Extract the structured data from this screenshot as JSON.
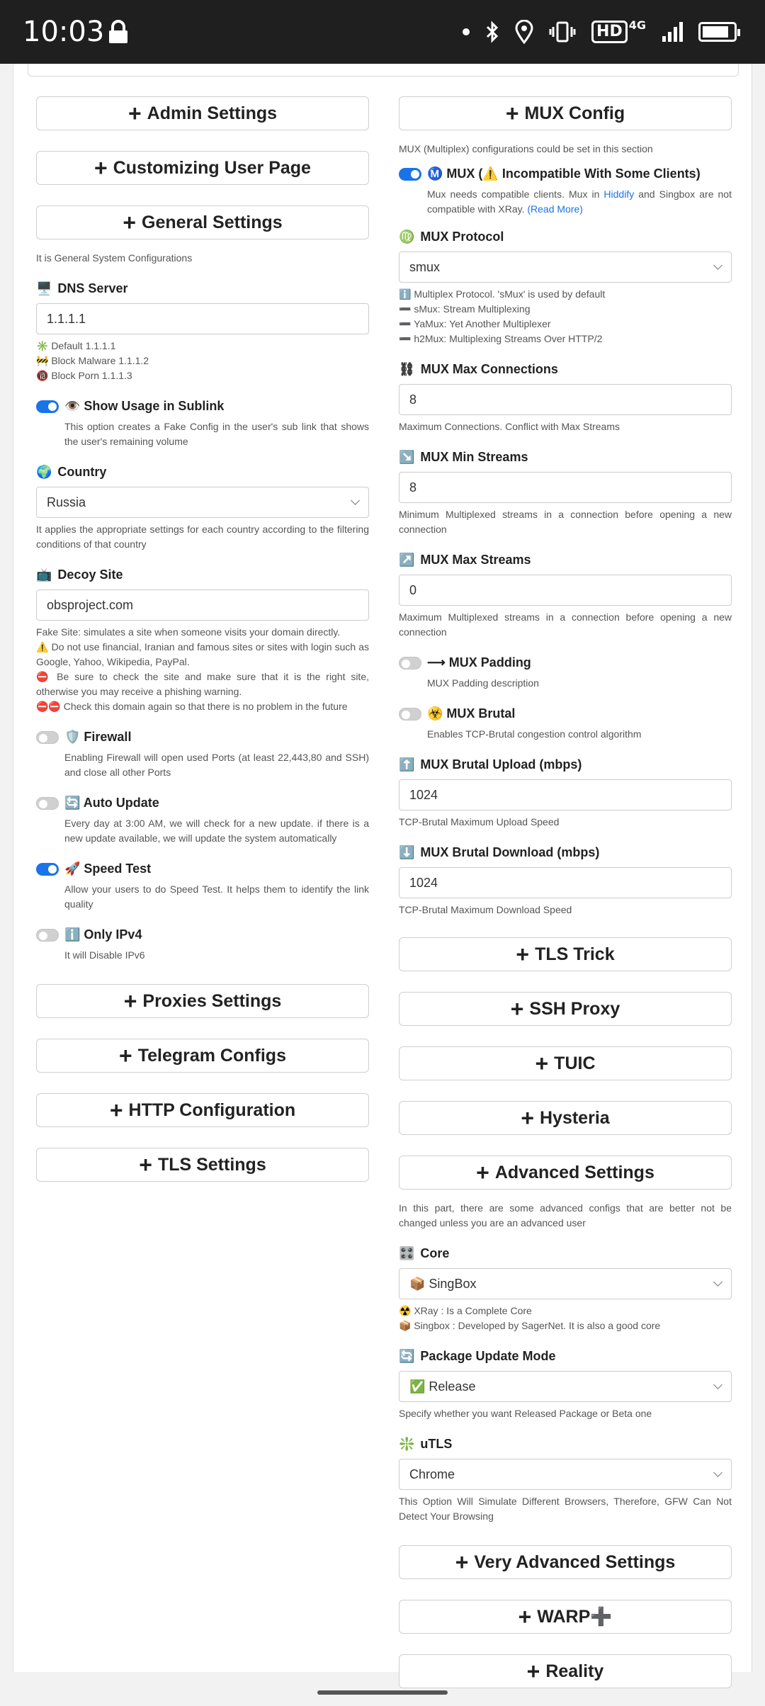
{
  "status_bar": {
    "time": "10:03",
    "network": "4G"
  },
  "left": {
    "admin_settings": "Admin Settings",
    "customizing_user_page": "Customizing User Page",
    "general_settings": "General Settings",
    "general_desc": "It is General System Configurations",
    "dns_label": "DNS Server",
    "dns_value": "1.1.1.1",
    "dns_hints": [
      "✳️ Default 1.1.1.1",
      "🚧 Block Malware 1.1.1.2",
      "🔞 Block Porn 1.1.1.3"
    ],
    "show_usage_label": "👁️ Show Usage in Sublink",
    "show_usage_desc": "This option creates a Fake Config in the user's sub link that shows the user's remaining volume",
    "country_label": "Country",
    "country_value": "Russia",
    "country_desc": "It applies the appropriate settings for each country according to the filtering conditions of that country",
    "decoy_label": "Decoy Site",
    "decoy_value": "obsproject.com",
    "decoy_notes": [
      "Fake Site: simulates a site when someone visits your domain directly.",
      "⚠️ Do not use financial, Iranian and famous sites or sites with login such as Google, Yahoo, Wikipedia, PayPal.",
      "⛔ Be sure to check the site and make sure that it is the right site, otherwise you may receive a phishing warning.",
      "⛔⛔ Check this domain again so that there is no problem in the future"
    ],
    "firewall_label": "🛡️ Firewall",
    "firewall_desc": "Enabling Firewall will open used Ports (at least 22,443,80 and SSH) and close all other Ports",
    "auto_update_label": "🔄 Auto Update",
    "auto_update_desc": "Every day at 3:00 AM, we will check for a new update. if there is a new update available, we will update the system automatically",
    "speed_test_label": "🚀 Speed Test",
    "speed_test_desc": "Allow your users to do Speed Test. It helps them to identify the link quality",
    "only_ipv4_label": "ℹ️ Only IPv4",
    "only_ipv4_desc": "It will Disable IPv6",
    "proxies_settings": "Proxies Settings",
    "telegram_configs": "Telegram Configs",
    "http_configuration": "HTTP Configuration",
    "tls_settings": "TLS Settings"
  },
  "right": {
    "mux_config": "MUX Config",
    "mux_config_desc": "MUX (Multiplex) configurations could be set in this section",
    "mux_label": "Ⓜ️ MUX (⚠️ Incompatible With Some Clients)",
    "mux_desc_1": "Mux needs compatible clients. Mux in ",
    "mux_desc_link": "Hiddify",
    "mux_desc_2": " and Singbox are not compatible with XRay. ",
    "mux_desc_readmore": "(Read More)",
    "mux_protocol_label": "MUX Protocol",
    "mux_protocol_value": "smux",
    "mux_protocol_hints": [
      "ℹ️ Multiplex Protocol. 'sMux' is used by default",
      "➖ sMux: Stream Multiplexing",
      "➖ YaMux: Yet Another Multiplexer",
      "➖ h2Mux: Multiplexing Streams Over HTTP/2"
    ],
    "max_conn_label": "MUX Max Connections",
    "max_conn_value": "8",
    "max_conn_desc": "Maximum Connections. Conflict with Max Streams",
    "min_streams_label": "MUX Min Streams",
    "min_streams_value": "8",
    "min_streams_desc": "Minimum Multiplexed streams in a connection before opening a new connection",
    "max_streams_label": "MUX Max Streams",
    "max_streams_value": "0",
    "max_streams_desc": "Maximum Multiplexed streams in a connection before opening a new connection",
    "padding_label": "⟶ MUX Padding",
    "padding_desc": "MUX Padding description",
    "brutal_label": "☣️ MUX Brutal",
    "brutal_desc": "Enables TCP-Brutal congestion control algorithm",
    "brutal_up_label": "MUX Brutal Upload (mbps)",
    "brutal_up_value": "1024",
    "brutal_up_desc": "TCP-Brutal Maximum Upload Speed",
    "brutal_down_label": "MUX Brutal Download (mbps)",
    "brutal_down_value": "1024",
    "brutal_down_desc": "TCP-Brutal Maximum Download Speed",
    "tls_trick": "TLS Trick",
    "ssh_proxy": "SSH Proxy",
    "tuic": "TUIC",
    "hysteria": "Hysteria",
    "advanced_settings": "Advanced Settings",
    "advanced_desc": "In this part, there are some advanced configs that are better not be changed unless you are an advanced user",
    "core_label": "Core",
    "core_value": "📦 SingBox",
    "core_hints": [
      "☢️ XRay : Is a Complete Core",
      "📦 Singbox : Developed by SagerNet. It is also a good core"
    ],
    "pkg_label": "Package Update Mode",
    "pkg_value": "✅ Release",
    "pkg_desc": "Specify whether you want Released Package or Beta one",
    "utls_label": "uTLS",
    "utls_value": "Chrome",
    "utls_desc": "This Option Will Simulate Different Browsers, Therefore, GFW Can Not Detect Your Browsing",
    "very_advanced": "Very Advanced Settings",
    "warp": "WARP➕",
    "reality": "Reality"
  }
}
